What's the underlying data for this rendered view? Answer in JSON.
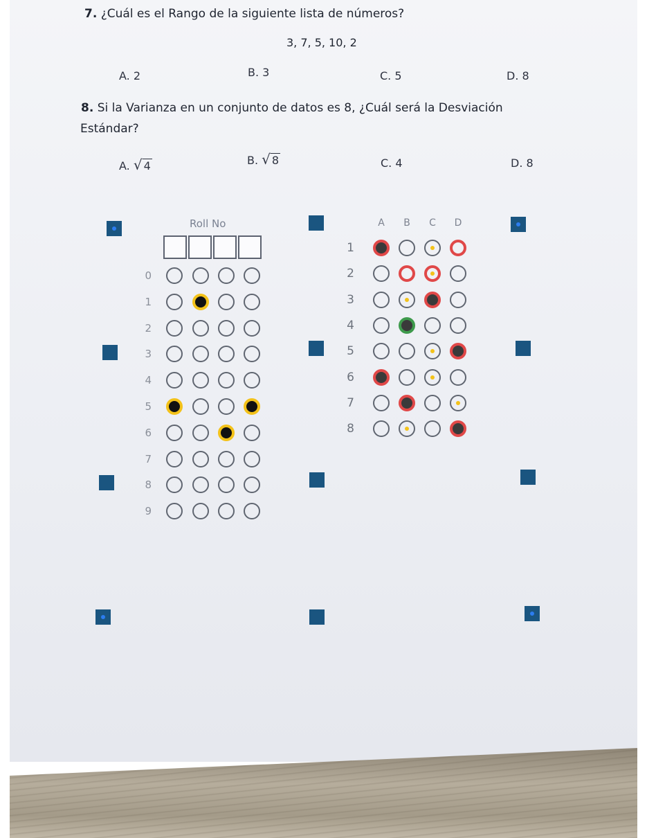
{
  "questions": [
    {
      "number": "7.",
      "text": "¿Cuál es el Rango de la siguiente lista de números?",
      "data_line": "3, 7, 5, 10, 2",
      "options": [
        "A. 2",
        "B. 3",
        "C. 5",
        "D. 8"
      ]
    },
    {
      "number": "8.",
      "text_line1": "Si la Varianza en un conjunto de datos es 8, ¿Cuál será la Desviación",
      "text_line2": "Estándar?",
      "options": [
        {
          "prefix": "A.",
          "sqrt": "4"
        },
        {
          "prefix": "B.",
          "sqrt": "8"
        },
        {
          "text": "C. 4"
        },
        {
          "text": "D. 8"
        }
      ]
    }
  ],
  "roll_no": {
    "header": "Roll No",
    "digits": [
      "0",
      "1",
      "2",
      "3",
      "4",
      "5",
      "6",
      "7",
      "8",
      "9"
    ],
    "filled": [
      [
        1,
        1
      ],
      [
        5,
        0
      ],
      [
        5,
        3
      ],
      [
        6,
        2
      ]
    ]
  },
  "answer_grid": {
    "columns": [
      "A",
      "B",
      "C",
      "D"
    ],
    "rows": [
      "1",
      "2",
      "3",
      "4",
      "5",
      "6",
      "7",
      "8"
    ]
  },
  "colors": {
    "marker": "#1a5580",
    "marker_dot": "#2c7df0",
    "correct_mark": "#e04848",
    "selected_mark": "#3e9a4c",
    "roll_fill": "#f3c21a"
  }
}
